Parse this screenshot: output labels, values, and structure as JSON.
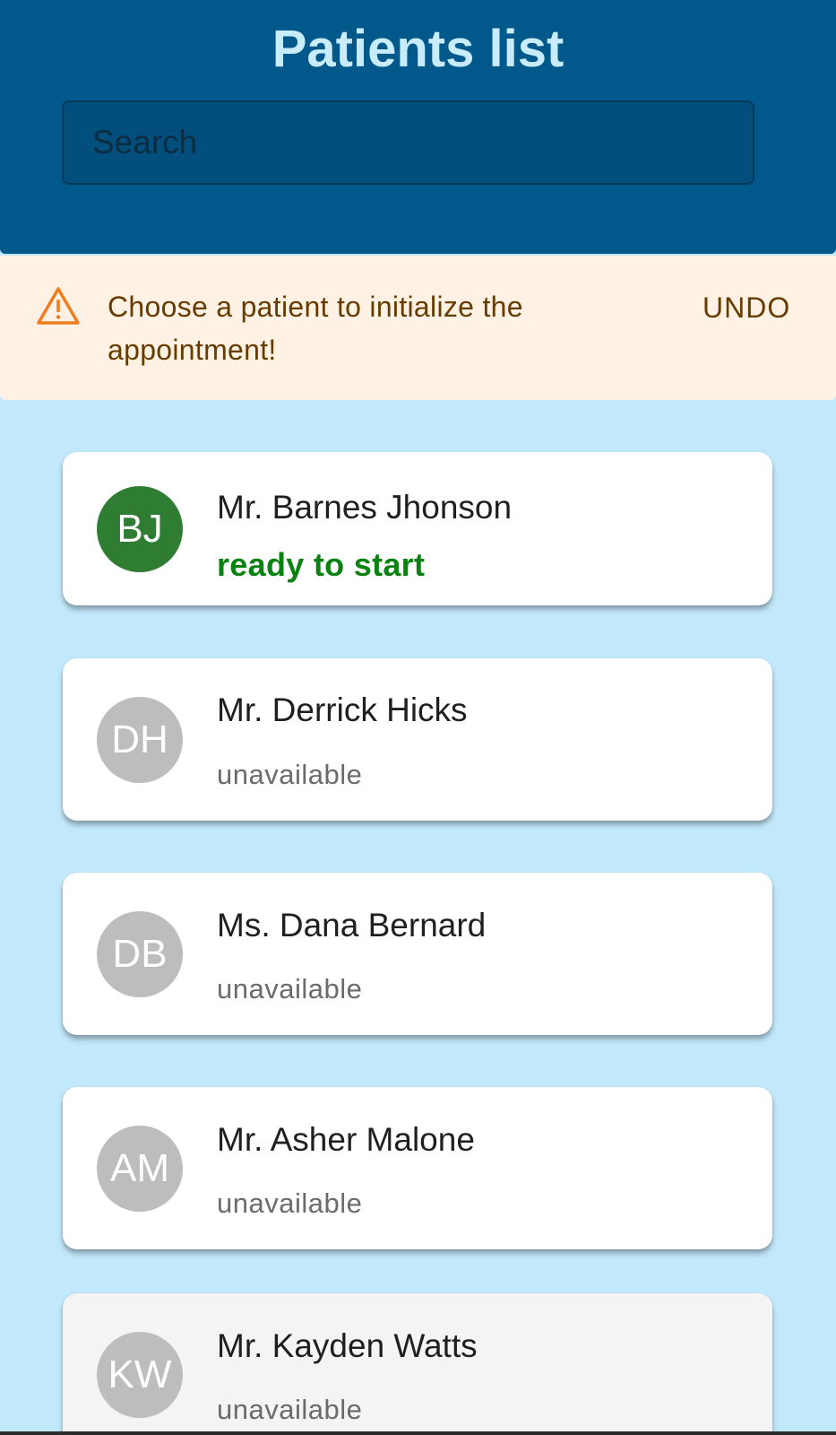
{
  "header": {
    "title": "Patients list",
    "search_placeholder": "Search",
    "search_value": ""
  },
  "alert": {
    "icon": "warning-triangle-icon",
    "message": "Choose a patient to initialize the appointment!",
    "action_label": "UNDO"
  },
  "patients": [
    {
      "initials": "BJ",
      "name": "Mr. Barnes Jhonson",
      "status": "ready to start"
    },
    {
      "initials": "DH",
      "name": "Mr. Derrick Hicks",
      "status": "unavailable"
    },
    {
      "initials": "DB",
      "name": "Ms. Dana Bernard",
      "status": "unavailable"
    },
    {
      "initials": "AM",
      "name": "Mr. Asher Malone",
      "status": "unavailable"
    },
    {
      "initials": "KW",
      "name": "Mr. Kayden Watts",
      "status": "unavailable"
    }
  ],
  "colors": {
    "header_bg": "#01588a",
    "title": "#c9ecfc",
    "page_bg": "#c2e8fb",
    "alert_bg": "#fff2e5",
    "alert_text": "#663c00",
    "warning_icon": "#ed7d1f",
    "ready_avatar": "#2e7d32",
    "ready_status": "#0a820f",
    "inactive_avatar": "#bdbdbd",
    "inactive_status": "#6b6b6b"
  }
}
